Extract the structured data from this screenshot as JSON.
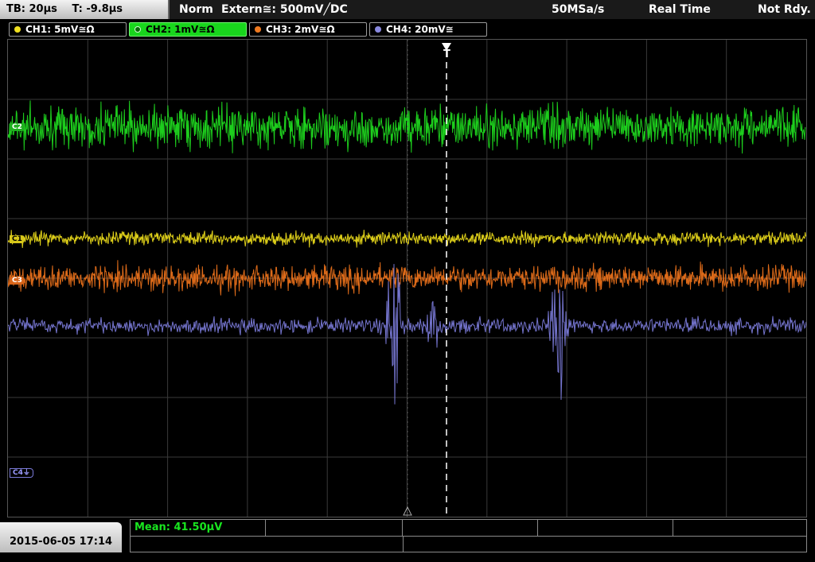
{
  "header": {
    "timebase": "TB: 20µs",
    "trigger_time": "T: -9.8µs",
    "trigger_mode": "Norm",
    "trigger_source": "Extern≅: 500mV╱DC",
    "sample_rate": "50MSa/s",
    "acq_mode": "Real Time",
    "status": "Not Rdy."
  },
  "channels": [
    {
      "label": "CH1: 5mV≅Ω",
      "color": "#f0e020",
      "active": false
    },
    {
      "label": "CH2: 1mV≅Ω",
      "color": "#22e022",
      "active": true
    },
    {
      "label": "CH3: 2mV≅Ω",
      "color": "#f07a20",
      "active": false
    },
    {
      "label": "CH4: 20mV≅",
      "color": "#8a8ae0",
      "active": false
    }
  ],
  "markers": {
    "c1": "C1",
    "c2": "C2",
    "c3": "C3",
    "c4": "C4⏚",
    "trigger": "T"
  },
  "footer": {
    "datetime": "2015-06-05 17:14",
    "measurement": "Mean: 41.50µV"
  },
  "colors": {
    "ch1": "#e8d81a",
    "ch2": "#1fd81f",
    "ch3": "#e8701a",
    "ch4": "#7a7ad8",
    "grid": "#3a3a3a"
  }
}
